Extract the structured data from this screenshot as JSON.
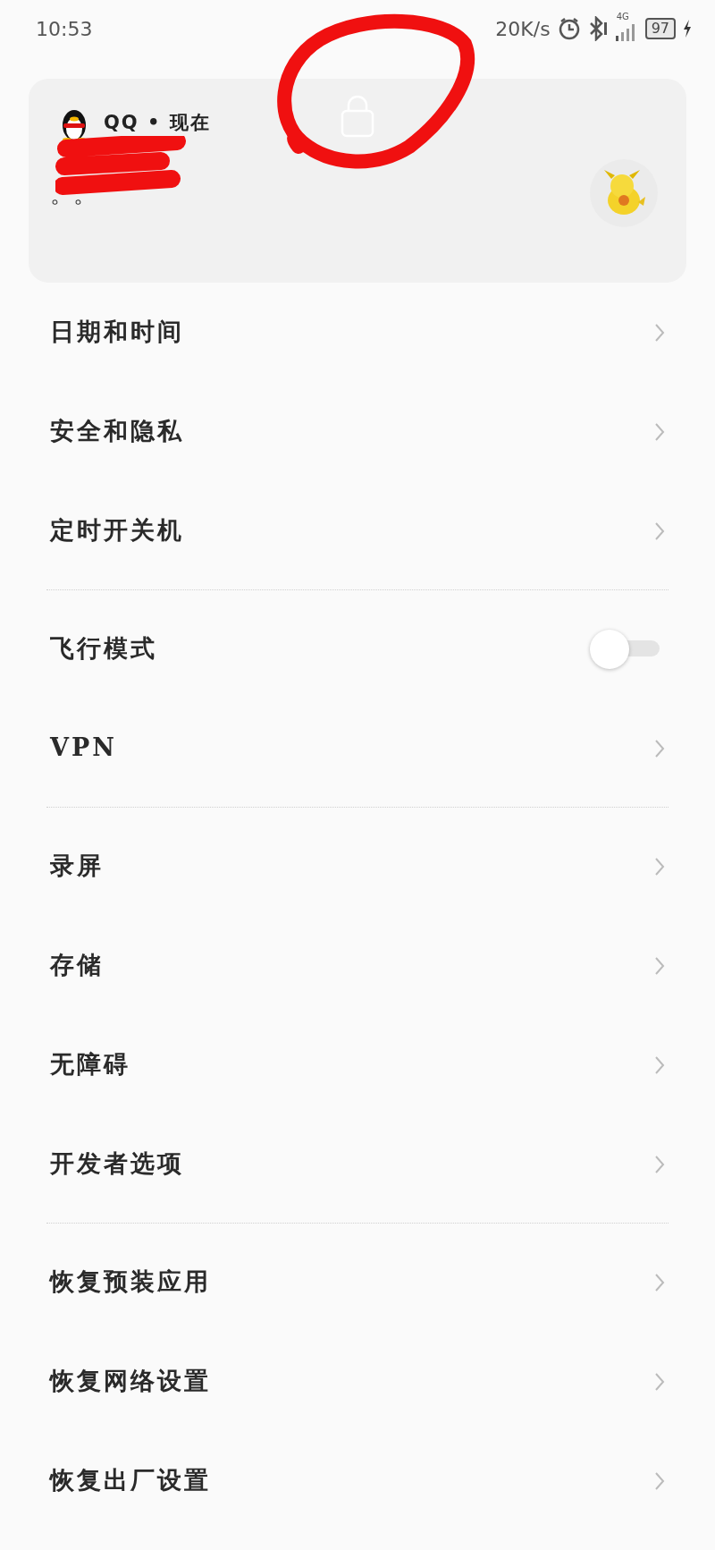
{
  "status_bar": {
    "time": "10:53",
    "net_speed": "20K/s",
    "network": "4G",
    "battery": "97"
  },
  "notification": {
    "app": "QQ",
    "separator": "•",
    "time": "现在",
    "message": "。。"
  },
  "sections": [
    {
      "items": [
        {
          "label": "日期和时间",
          "kind": "link"
        },
        {
          "label": "安全和隐私",
          "kind": "link"
        },
        {
          "label": "定时开关机",
          "kind": "link"
        }
      ]
    },
    {
      "items": [
        {
          "label": "飞行模式",
          "kind": "switch",
          "on": false
        },
        {
          "label": "VPN",
          "kind": "link"
        }
      ]
    },
    {
      "items": [
        {
          "label": "录屏",
          "kind": "link"
        },
        {
          "label": "存储",
          "kind": "link"
        },
        {
          "label": "无障碍",
          "kind": "link"
        },
        {
          "label": "开发者选项",
          "kind": "link"
        }
      ]
    },
    {
      "items": [
        {
          "label": "恢复预装应用",
          "kind": "link"
        },
        {
          "label": "恢复网络设置",
          "kind": "link"
        },
        {
          "label": "恢复出厂设置",
          "kind": "link"
        }
      ]
    }
  ]
}
